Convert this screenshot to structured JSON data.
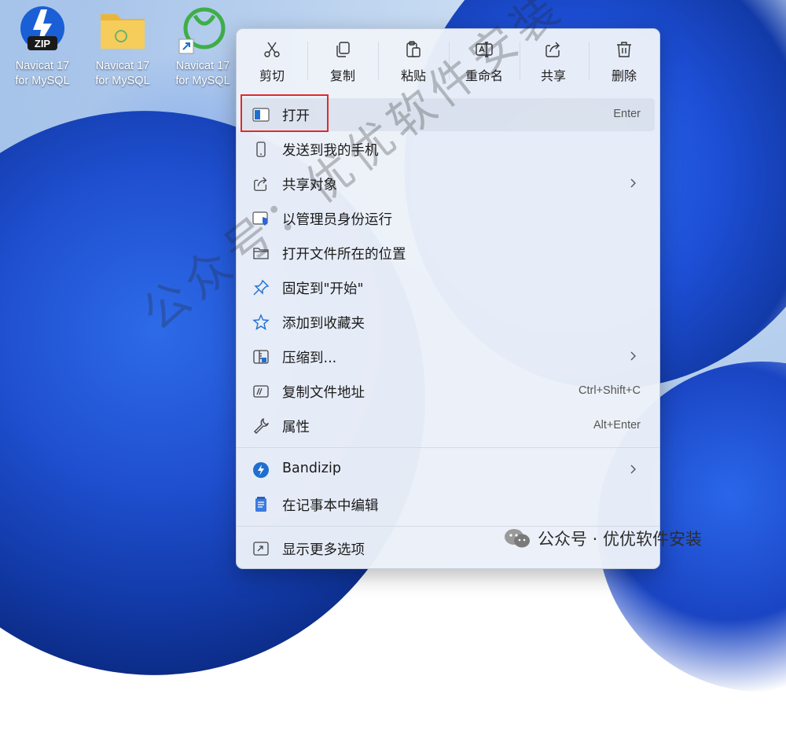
{
  "desktop": {
    "icons": [
      {
        "line1": "Navicat 17",
        "line2": "for MySQL",
        "kind": "zip-archive-icon",
        "badge": "ZIP"
      },
      {
        "line1": "Navicat 17",
        "line2": "for MySQL",
        "kind": "folder-icon"
      },
      {
        "line1": "Navicat 17",
        "line2": "for MySQL",
        "kind": "navicat-shortcut-icon"
      }
    ]
  },
  "context_menu": {
    "toolbar": [
      {
        "label": "剪切",
        "icon": "scissors-icon"
      },
      {
        "label": "复制",
        "icon": "copy-icon"
      },
      {
        "label": "粘贴",
        "icon": "paste-icon"
      },
      {
        "label": "重命名",
        "icon": "rename-icon"
      },
      {
        "label": "共享",
        "icon": "share-icon"
      },
      {
        "label": "删除",
        "icon": "trash-icon"
      }
    ],
    "items": [
      {
        "label": "打开",
        "shortcut": "Enter",
        "icon": "open-window-icon",
        "highlighted": true
      },
      {
        "label": "发送到我的手机",
        "icon": "phone-icon"
      },
      {
        "label": "共享对象",
        "icon": "share-icon",
        "submenu": true
      },
      {
        "label": "以管理员身份运行",
        "icon": "admin-shield-icon"
      },
      {
        "label": "打开文件所在的位置",
        "icon": "folder-outline-icon"
      },
      {
        "label": "固定到\"开始\"",
        "icon": "pin-icon"
      },
      {
        "label": "添加到收藏夹",
        "icon": "star-icon"
      },
      {
        "label": "压缩到...",
        "icon": "zip-icon",
        "submenu": true
      },
      {
        "label": "复制文件地址",
        "shortcut": "Ctrl+Shift+C",
        "icon": "copy-path-icon"
      },
      {
        "label": "属性",
        "shortcut": "Alt+Enter",
        "icon": "wrench-icon"
      },
      {
        "label": "Bandizip",
        "icon": "bandizip-icon",
        "submenu": true
      },
      {
        "label": "在记事本中编辑",
        "icon": "notepad-icon"
      },
      {
        "label": "显示更多选项",
        "icon": "more-options-icon"
      }
    ]
  },
  "watermark": {
    "diagonal": "公众号：优优软件安装",
    "corner": "公众号 · 优优软件安装"
  },
  "colors": {
    "highlight_box": "#e02b2b",
    "accent_blue": "#1f6fd1",
    "admin_shield": "#2b64d6"
  }
}
